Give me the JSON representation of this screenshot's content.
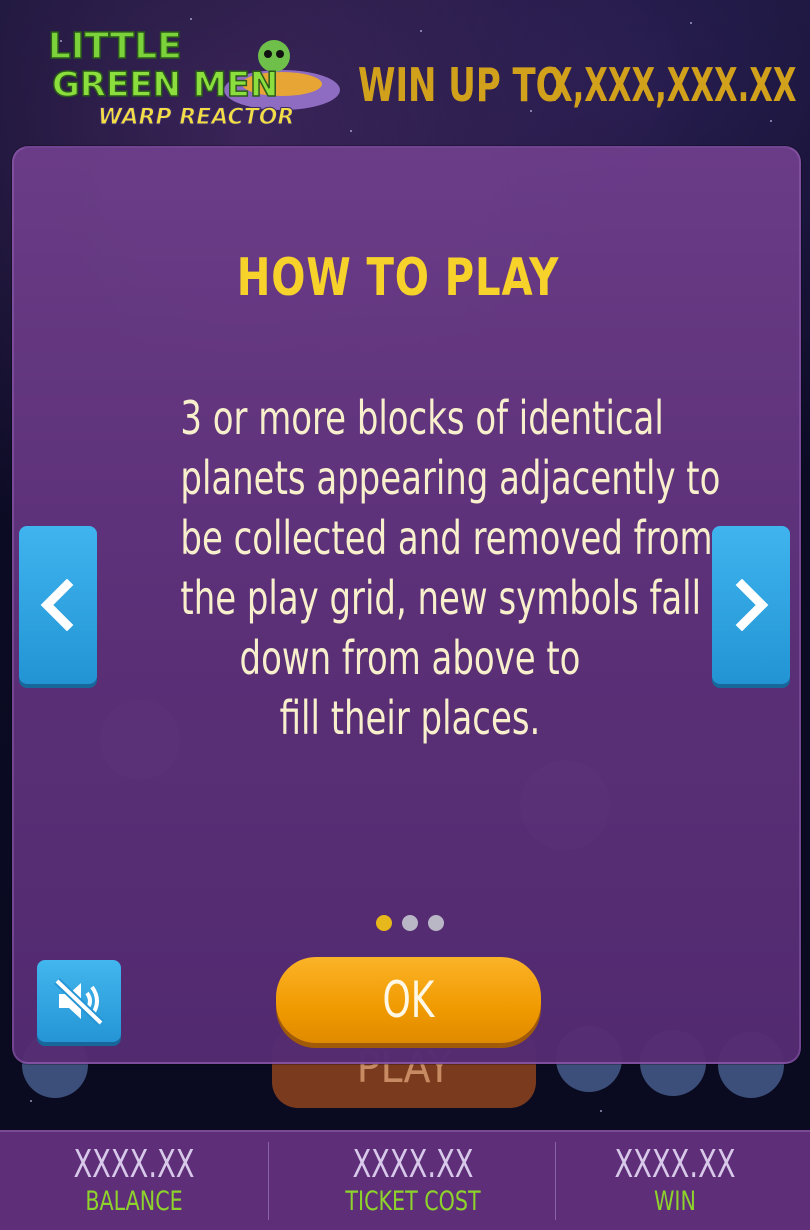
{
  "header": {
    "logo_text": "Little Green Men Warp Reactor",
    "win_up_to_label": "WIN UP TO",
    "win_amount": "X,XXX,XXX.XX"
  },
  "background": {
    "play_label": "PLAY"
  },
  "modal": {
    "title": "HOW TO PLAY",
    "body_lines": [
      "3 or more blocks of identical",
      "planets appearing adjacently to",
      "be collected and removed from",
      "the play grid, new symbols fall",
      "down from above to",
      "fill their places."
    ],
    "page_count": 3,
    "active_page": 1,
    "ok_label": "OK"
  },
  "footer": {
    "balance_value": "XXXX.XX",
    "balance_label": "BALANCE",
    "ticket_value": "XXXX.XX",
    "ticket_label": "TICKET COST",
    "win_value": "XXXX.XX",
    "win_label": "WIN"
  },
  "colors": {
    "title_yellow": "#f6d22b",
    "modal_purple": "#6d3d8a",
    "nav_blue": "#2a9ad9",
    "ok_orange": "#f5a20b",
    "footer_label_green": "#8ed32b"
  }
}
